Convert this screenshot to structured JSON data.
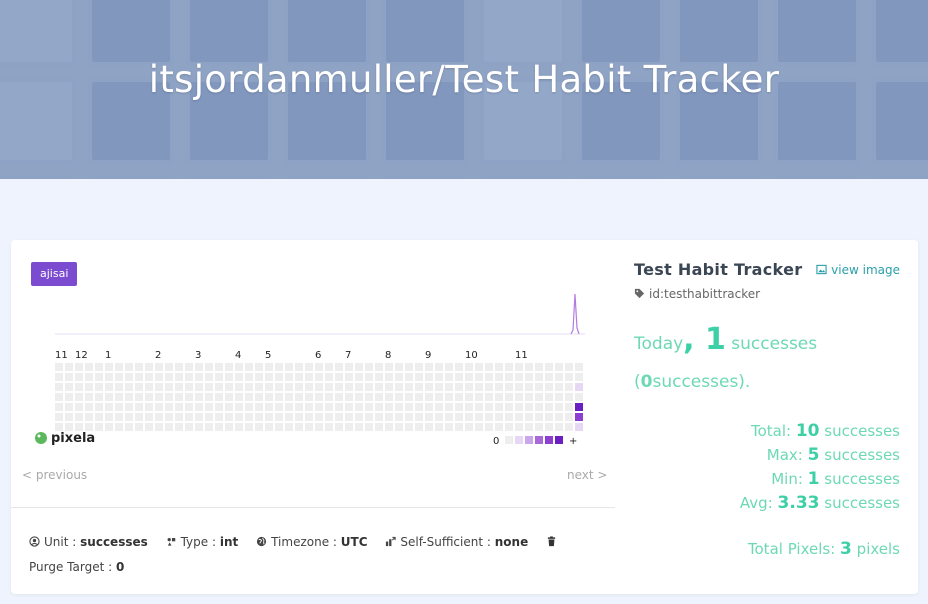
{
  "page": {
    "title": "itsjordanmuller/Test Habit Tracker"
  },
  "graph_card": {
    "theme_tag": "ajisai",
    "month_labels": [
      "11",
      "12",
      "1",
      "2",
      "3",
      "4",
      "5",
      "6",
      "7",
      "8",
      "9",
      "10",
      "11"
    ],
    "legend_min": "0",
    "legend_max": "+",
    "logo_text": "pixela",
    "prev_label": "< previous",
    "next_label": "next >",
    "colors": {
      "empty": "#eeeeee",
      "level1": "#e6d7f5",
      "level2": "#caa7ec",
      "level3": "#a86ad9",
      "level4": "#8c3fd1",
      "level5": "#6a1fc2",
      "line": "#b37be0"
    },
    "pixels": [
      {
        "date": "recent-1",
        "value": 5
      },
      {
        "date": "recent-2",
        "value": 4
      },
      {
        "date": "today",
        "value": 1
      }
    ]
  },
  "properties": {
    "unit_label": "Unit",
    "unit_value": "successes",
    "type_label": "Type",
    "type_value": "int",
    "timezone_label": "Timezone",
    "timezone_value": "UTC",
    "self_sufficient_label": "Self-Sufficient",
    "self_sufficient_value": "none",
    "purge_label": "Purge Target",
    "purge_value": "0",
    "separator": ":"
  },
  "sidebar": {
    "graph_name": "Test Habit Tracker",
    "view_image": "view image",
    "graph_id": "id:testhabittracker",
    "today_prefix": "Today",
    "today_value": "1",
    "today_unit": "successes (",
    "today_zero": "0",
    "today_suffix": "successes).",
    "stats": [
      {
        "label": "Total:",
        "value": "10",
        "unit": "successes"
      },
      {
        "label": "Max:",
        "value": "5",
        "unit": "successes"
      },
      {
        "label": "Min:",
        "value": "1",
        "unit": "successes"
      },
      {
        "label": "Avg:",
        "value": "3.33",
        "unit": "successes"
      }
    ],
    "total_pixels_label": "Total Pixels:",
    "total_pixels_value": "3",
    "total_pixels_unit": "pixels"
  }
}
